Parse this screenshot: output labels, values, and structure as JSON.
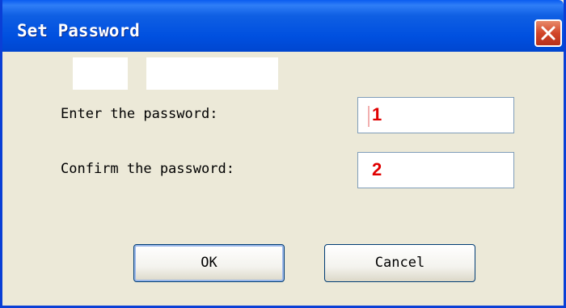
{
  "dialog": {
    "title": "Set Password",
    "close_icon": "close-icon",
    "fields": [
      {
        "label": "Enter the password:",
        "value": "1"
      },
      {
        "label": "Confirm the password:",
        "value": "2"
      }
    ],
    "buttons": {
      "ok_label": "OK",
      "cancel_label": "Cancel"
    }
  },
  "colors": {
    "titlebar": "#0050e0",
    "dialog_background": "#ece9d8",
    "close_button": "#d2462a",
    "field_value": "#e00000"
  }
}
